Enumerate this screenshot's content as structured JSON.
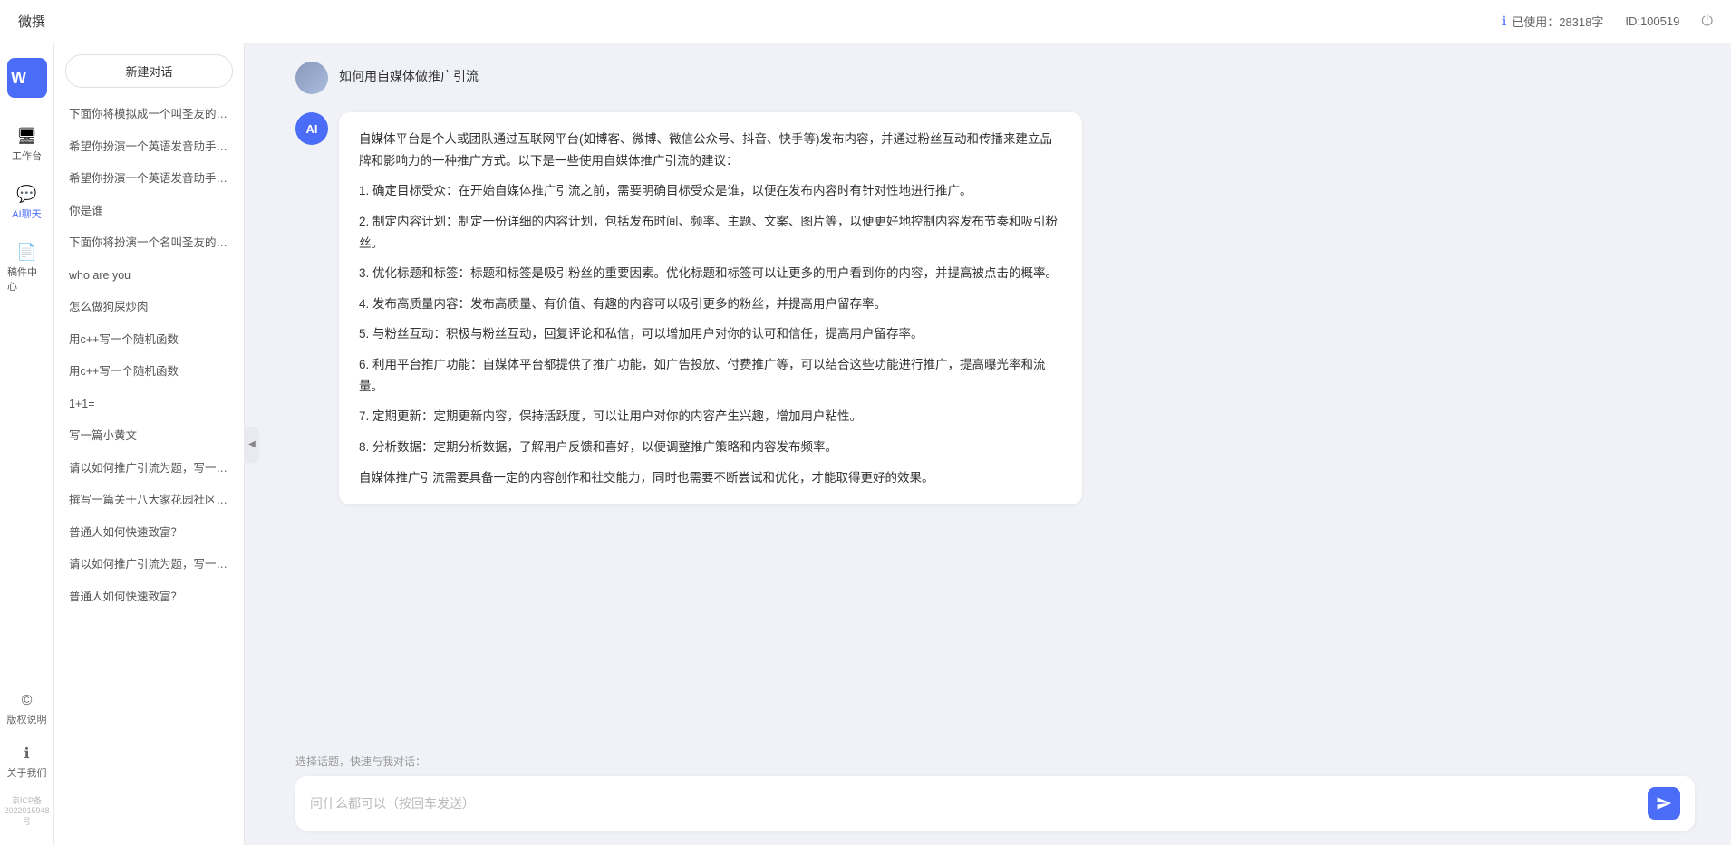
{
  "topbar": {
    "title": "微撰",
    "usage_label": "已使用：28318字",
    "usage_icon": "info-icon",
    "id_label": "ID:100519",
    "logout_icon": "logout-icon"
  },
  "icon_sidebar": {
    "brand": "W微撰",
    "nav_items": [
      {
        "id": "workbench",
        "icon": "🖥",
        "label": "工作台"
      },
      {
        "id": "ai-chat",
        "icon": "💬",
        "label": "AI聊天",
        "active": true
      },
      {
        "id": "draft",
        "icon": "📄",
        "label": "稿件中心"
      }
    ],
    "bottom_items": [
      {
        "id": "copyright",
        "icon": "©",
        "label": "版权说明"
      },
      {
        "id": "about",
        "icon": "ℹ",
        "label": "关于我们"
      }
    ],
    "icp": "京ICP备2022015948号"
  },
  "history_sidebar": {
    "new_chat_label": "新建对话",
    "items": [
      "下面你将模拟成一个叫圣友的程序员、我说...",
      "希望你扮演一个英语发音助手，我提供给你...",
      "希望你扮演一个英语发音助手，我提供给你...",
      "你是谁",
      "下面你将扮演一个名叫圣友的医生",
      "who are you",
      "怎么做狗屎炒肉",
      "用c++写一个随机函数",
      "用c++写一个随机函数",
      "1+1=",
      "写一篇小黄文",
      "请以如何推广引流为题，写一篇大纲",
      "撰写一篇关于八大家花园社区一刻钟便民生...",
      "普通人如何快速致富？",
      "请以如何推广引流为题，写一篇大纲",
      "普通人如何快速致富？"
    ]
  },
  "chat": {
    "user_message": "如何用自媒体做推广引流",
    "ai_response_paragraphs": [
      "自媒体平台是个人或团队通过互联网平台(如博客、微博、微信公众号、抖音、快手等)发布内容，并通过粉丝互动和传播来建立品牌和影响力的一种推广方式。以下是一些使用自媒体推广引流的建议：",
      "1. 确定目标受众：在开始自媒体推广引流之前，需要明确目标受众是谁，以便在发布内容时有针对性地进行推广。",
      "2. 制定内容计划：制定一份详细的内容计划，包括发布时间、频率、主题、文案、图片等，以便更好地控制内容发布节奏和吸引粉丝。",
      "3. 优化标题和标签：标题和标签是吸引粉丝的重要因素。优化标题和标签可以让更多的用户看到你的内容，并提高被点击的概率。",
      "4. 发布高质量内容：发布高质量、有价值、有趣的内容可以吸引更多的粉丝，并提高用户留存率。",
      "5. 与粉丝互动：积极与粉丝互动，回复评论和私信，可以增加用户对你的认可和信任，提高用户留存率。",
      "6. 利用平台推广功能：自媒体平台都提供了推广功能，如广告投放、付费推广等，可以结合这些功能进行推广，提高曝光率和流量。",
      "7. 定期更新：定期更新内容，保持活跃度，可以让用户对你的内容产生兴趣，增加用户粘性。",
      "8. 分析数据：定期分析数据，了解用户反馈和喜好，以便调整推广策略和内容发布频率。",
      "自媒体推广引流需要具备一定的内容创作和社交能力，同时也需要不断尝试和优化，才能取得更好的效果。"
    ]
  },
  "input_area": {
    "quick_label": "选择话题，快速与我对话：",
    "placeholder": "问什么都可以（按回车发送）",
    "send_icon": "send-icon"
  }
}
